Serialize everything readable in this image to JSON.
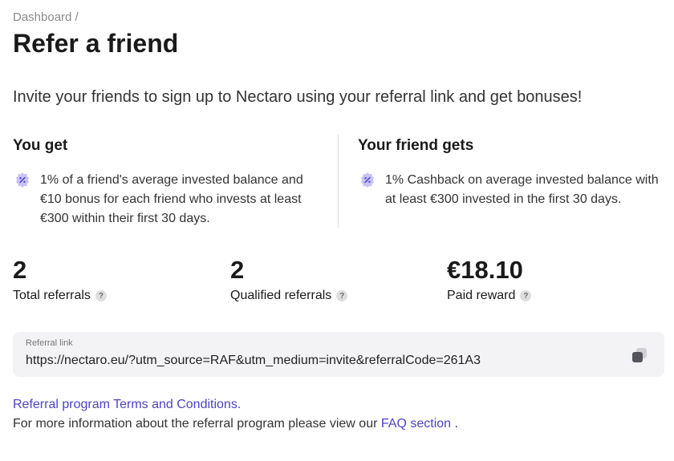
{
  "breadcrumb": "Dashboard /",
  "title": "Refer a friend",
  "intro": "Invite your friends to sign up to Nectaro using your referral link and get bonuses!",
  "you_get": {
    "heading": "You get",
    "text": "1% of a friend's average invested balance and €10 bonus for each friend who invests at least €300 within their first 30 days."
  },
  "friend_gets": {
    "heading": "Your friend gets",
    "text": "1% Cashback on average invested balance with at least €300 invested in the first 30 days."
  },
  "stats": [
    {
      "value": "2",
      "label": "Total referrals"
    },
    {
      "value": "2",
      "label": "Qualified referrals"
    },
    {
      "value": "€18.10",
      "label": "Paid reward"
    }
  ],
  "help_glyph": "?",
  "referral": {
    "label": "Referral link",
    "url": "https://nectaro.eu/?utm_source=RAF&utm_medium=invite&referralCode=261A3"
  },
  "footer": {
    "terms_link": "Referral program Terms and Conditions.",
    "more_text": "For more information about the referral program please view our",
    "faq_link": "FAQ section",
    "period": "."
  },
  "colors": {
    "accent": "#4c43c4",
    "badge": "#c9c2f7",
    "panel": "#f3f3f5"
  },
  "icons": {
    "benefit": "percent-badge-icon",
    "copy": "copy-icon",
    "help": "question-icon"
  }
}
